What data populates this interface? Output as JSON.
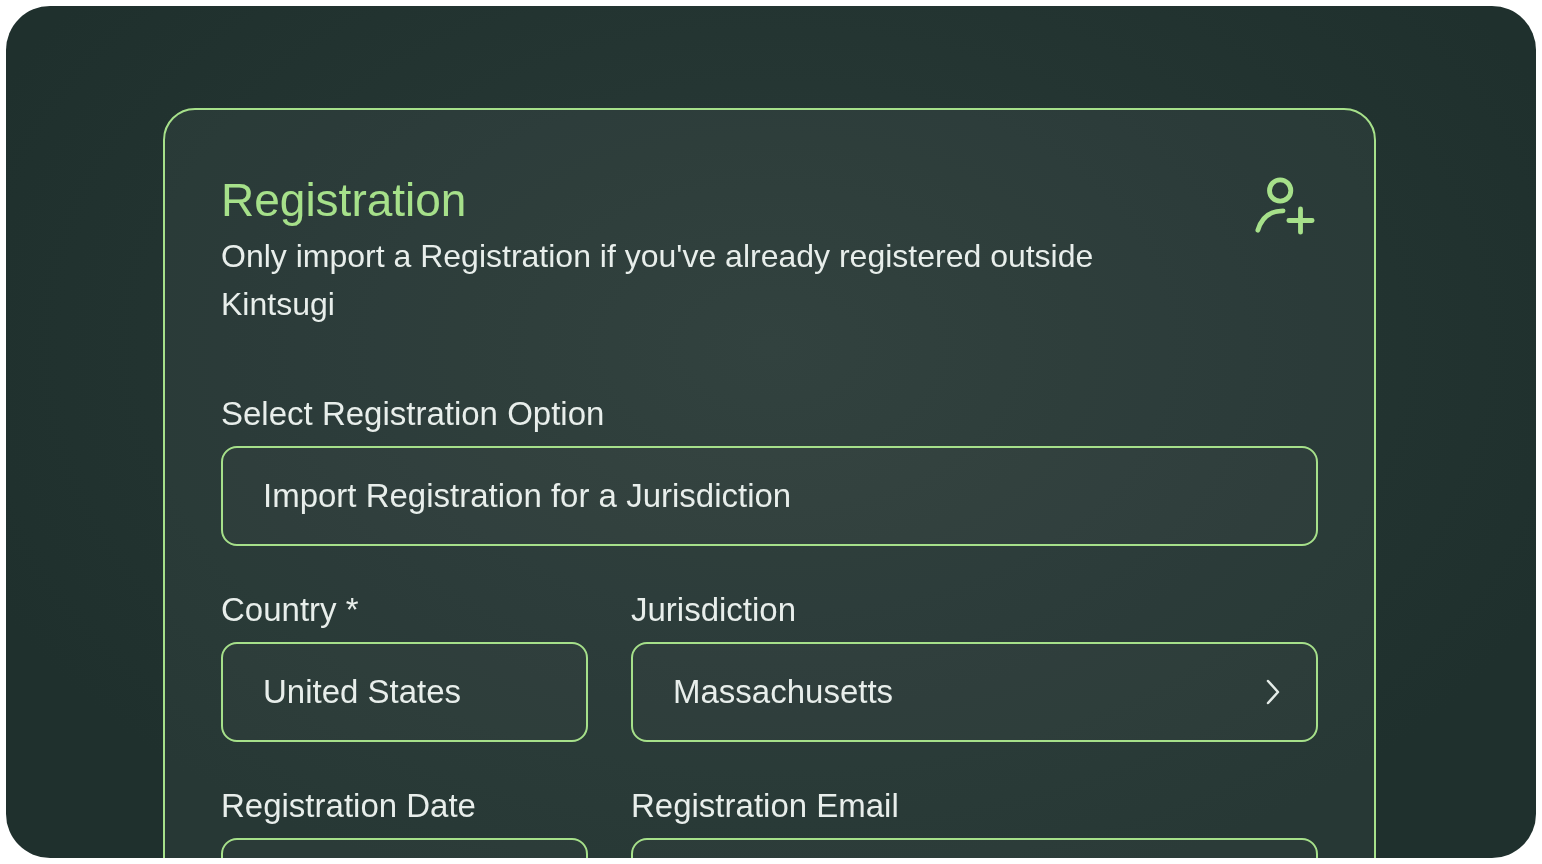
{
  "card": {
    "title": "Registration",
    "subtitle": "Only import a Registration if you've already registered outside Kintsugi"
  },
  "option_field": {
    "label": "Select Registration Option",
    "value": "Import Registration for a Jurisdiction"
  },
  "fields": [
    {
      "label": "Country *",
      "value": "United States",
      "kind": "text"
    },
    {
      "label": "Jurisdiction",
      "value": "Massachusetts",
      "kind": "link"
    },
    {
      "label": "Registration Date",
      "kind": "text"
    },
    {
      "label": "Registration Email",
      "kind": "text"
    }
  ]
}
